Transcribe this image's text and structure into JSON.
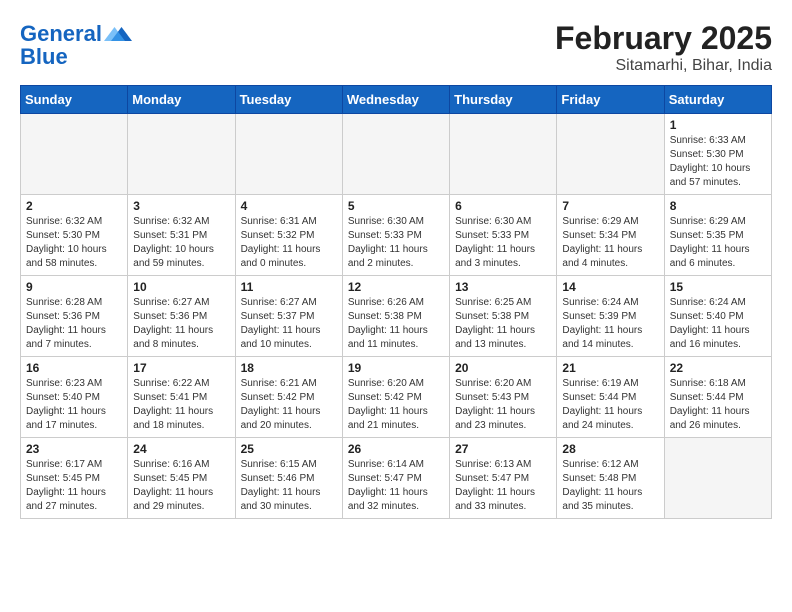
{
  "header": {
    "logo_line1": "General",
    "logo_line2": "Blue",
    "month_year": "February 2025",
    "location": "Sitamarhi, Bihar, India"
  },
  "weekdays": [
    "Sunday",
    "Monday",
    "Tuesday",
    "Wednesday",
    "Thursday",
    "Friday",
    "Saturday"
  ],
  "weeks": [
    [
      {
        "day": "",
        "info": ""
      },
      {
        "day": "",
        "info": ""
      },
      {
        "day": "",
        "info": ""
      },
      {
        "day": "",
        "info": ""
      },
      {
        "day": "",
        "info": ""
      },
      {
        "day": "",
        "info": ""
      },
      {
        "day": "1",
        "info": "Sunrise: 6:33 AM\nSunset: 5:30 PM\nDaylight: 10 hours\nand 57 minutes."
      }
    ],
    [
      {
        "day": "2",
        "info": "Sunrise: 6:32 AM\nSunset: 5:30 PM\nDaylight: 10 hours\nand 58 minutes."
      },
      {
        "day": "3",
        "info": "Sunrise: 6:32 AM\nSunset: 5:31 PM\nDaylight: 10 hours\nand 59 minutes."
      },
      {
        "day": "4",
        "info": "Sunrise: 6:31 AM\nSunset: 5:32 PM\nDaylight: 11 hours\nand 0 minutes."
      },
      {
        "day": "5",
        "info": "Sunrise: 6:30 AM\nSunset: 5:33 PM\nDaylight: 11 hours\nand 2 minutes."
      },
      {
        "day": "6",
        "info": "Sunrise: 6:30 AM\nSunset: 5:33 PM\nDaylight: 11 hours\nand 3 minutes."
      },
      {
        "day": "7",
        "info": "Sunrise: 6:29 AM\nSunset: 5:34 PM\nDaylight: 11 hours\nand 4 minutes."
      },
      {
        "day": "8",
        "info": "Sunrise: 6:29 AM\nSunset: 5:35 PM\nDaylight: 11 hours\nand 6 minutes."
      }
    ],
    [
      {
        "day": "9",
        "info": "Sunrise: 6:28 AM\nSunset: 5:36 PM\nDaylight: 11 hours\nand 7 minutes."
      },
      {
        "day": "10",
        "info": "Sunrise: 6:27 AM\nSunset: 5:36 PM\nDaylight: 11 hours\nand 8 minutes."
      },
      {
        "day": "11",
        "info": "Sunrise: 6:27 AM\nSunset: 5:37 PM\nDaylight: 11 hours\nand 10 minutes."
      },
      {
        "day": "12",
        "info": "Sunrise: 6:26 AM\nSunset: 5:38 PM\nDaylight: 11 hours\nand 11 minutes."
      },
      {
        "day": "13",
        "info": "Sunrise: 6:25 AM\nSunset: 5:38 PM\nDaylight: 11 hours\nand 13 minutes."
      },
      {
        "day": "14",
        "info": "Sunrise: 6:24 AM\nSunset: 5:39 PM\nDaylight: 11 hours\nand 14 minutes."
      },
      {
        "day": "15",
        "info": "Sunrise: 6:24 AM\nSunset: 5:40 PM\nDaylight: 11 hours\nand 16 minutes."
      }
    ],
    [
      {
        "day": "16",
        "info": "Sunrise: 6:23 AM\nSunset: 5:40 PM\nDaylight: 11 hours\nand 17 minutes."
      },
      {
        "day": "17",
        "info": "Sunrise: 6:22 AM\nSunset: 5:41 PM\nDaylight: 11 hours\nand 18 minutes."
      },
      {
        "day": "18",
        "info": "Sunrise: 6:21 AM\nSunset: 5:42 PM\nDaylight: 11 hours\nand 20 minutes."
      },
      {
        "day": "19",
        "info": "Sunrise: 6:20 AM\nSunset: 5:42 PM\nDaylight: 11 hours\nand 21 minutes."
      },
      {
        "day": "20",
        "info": "Sunrise: 6:20 AM\nSunset: 5:43 PM\nDaylight: 11 hours\nand 23 minutes."
      },
      {
        "day": "21",
        "info": "Sunrise: 6:19 AM\nSunset: 5:44 PM\nDaylight: 11 hours\nand 24 minutes."
      },
      {
        "day": "22",
        "info": "Sunrise: 6:18 AM\nSunset: 5:44 PM\nDaylight: 11 hours\nand 26 minutes."
      }
    ],
    [
      {
        "day": "23",
        "info": "Sunrise: 6:17 AM\nSunset: 5:45 PM\nDaylight: 11 hours\nand 27 minutes."
      },
      {
        "day": "24",
        "info": "Sunrise: 6:16 AM\nSunset: 5:45 PM\nDaylight: 11 hours\nand 29 minutes."
      },
      {
        "day": "25",
        "info": "Sunrise: 6:15 AM\nSunset: 5:46 PM\nDaylight: 11 hours\nand 30 minutes."
      },
      {
        "day": "26",
        "info": "Sunrise: 6:14 AM\nSunset: 5:47 PM\nDaylight: 11 hours\nand 32 minutes."
      },
      {
        "day": "27",
        "info": "Sunrise: 6:13 AM\nSunset: 5:47 PM\nDaylight: 11 hours\nand 33 minutes."
      },
      {
        "day": "28",
        "info": "Sunrise: 6:12 AM\nSunset: 5:48 PM\nDaylight: 11 hours\nand 35 minutes."
      },
      {
        "day": "",
        "info": ""
      }
    ]
  ]
}
